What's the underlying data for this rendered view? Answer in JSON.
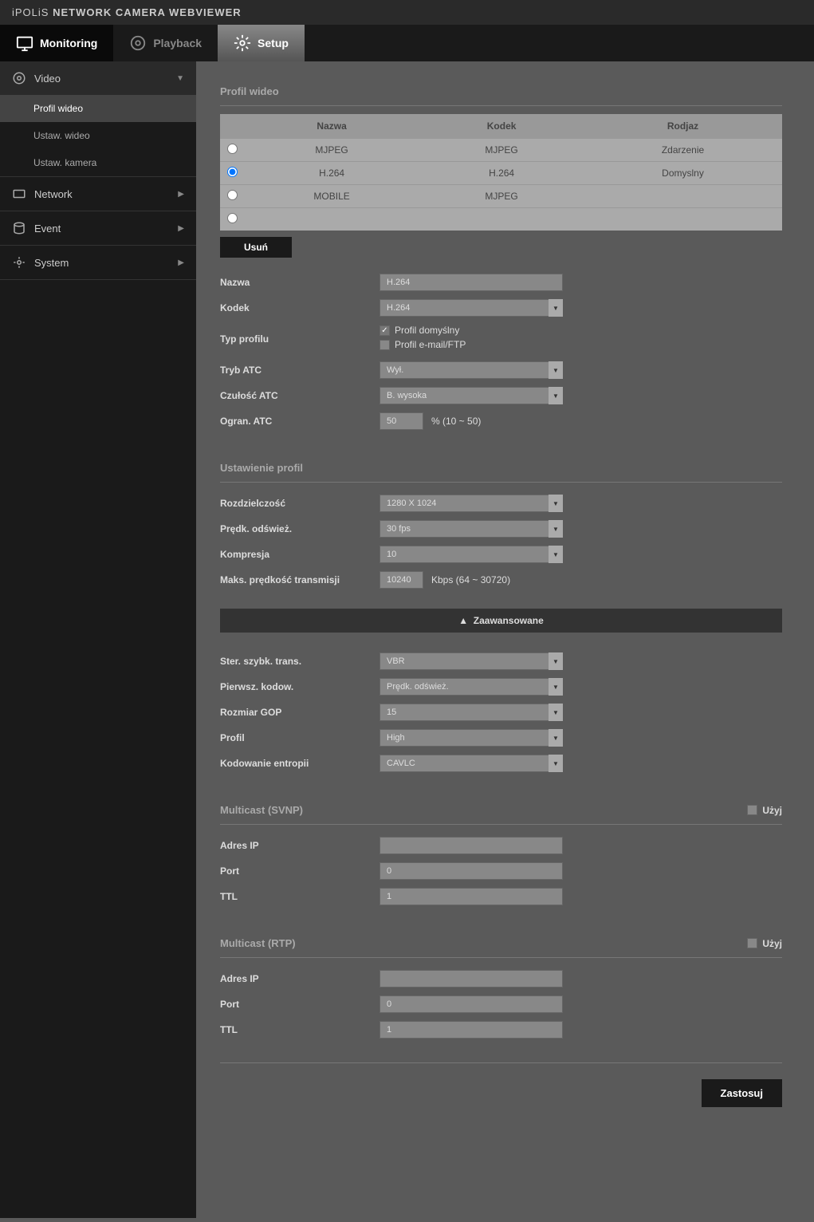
{
  "header": {
    "brand1": "iPOLiS",
    "brand2": " NETWORK CAMERA WEBVIEWER"
  },
  "tabs": {
    "monitoring": "Monitoring",
    "playback": "Playback",
    "setup": "Setup"
  },
  "sidebar": {
    "video": {
      "label": "Video",
      "items": [
        "Profil wideo",
        "Ustaw. wideo",
        "Ustaw. kamera"
      ]
    },
    "network": "Network",
    "event": "Event",
    "system": "System"
  },
  "section1": {
    "title": "Profil wideo",
    "headers": {
      "name": "Nazwa",
      "codec": "Kodek",
      "type": "Rodjaz"
    },
    "rows": [
      {
        "name": "MJPEG",
        "codec": "MJPEG",
        "type": "Zdarzenie"
      },
      {
        "name": "H.264",
        "codec": "H.264",
        "type": "Domyslny"
      },
      {
        "name": "MOBILE",
        "codec": "MJPEG",
        "type": ""
      },
      {
        "name": "",
        "codec": "",
        "type": ""
      }
    ],
    "delete": "Usuń"
  },
  "form": {
    "name_label": "Nazwa",
    "name_value": "H.264",
    "codec_label": "Kodek",
    "codec_value": "H.264",
    "profiletype_label": "Typ profilu",
    "profiletype_default": "Profil domyślny",
    "profiletype_email": "Profil e-mail/FTP",
    "atcmode_label": "Tryb ATC",
    "atcmode_value": "Wył.",
    "atcsens_label": "Czułość ATC",
    "atcsens_value": "B. wysoka",
    "atclimit_label": "Ogran. ATC",
    "atclimit_value": "50",
    "atclimit_hint": "% (10 ~ 50)"
  },
  "section2": {
    "title": "Ustawienie profil",
    "resolution_label": "Rozdzielczość",
    "resolution_value": "1280 X 1024",
    "framerate_label": "Prędk. odśwież.",
    "framerate_value": "30 fps",
    "compression_label": "Kompresja",
    "compression_value": "10",
    "maxbitrate_label": "Maks. prędkość transmisji",
    "maxbitrate_value": "10240",
    "maxbitrate_hint": "Kbps (64 ~ 30720)"
  },
  "advanced": {
    "title": "Zaawansowane",
    "bitratectl_label": "Ster. szybk. trans.",
    "bitratectl_value": "VBR",
    "encprio_label": "Pierwsz. kodow.",
    "encprio_value": "Prędk. odśwież.",
    "gop_label": "Rozmiar GOP",
    "gop_value": "15",
    "profile_label": "Profil",
    "profile_value": "High",
    "entropy_label": "Kodowanie entropii",
    "entropy_value": "CAVLC"
  },
  "multicast_svnp": {
    "title": "Multicast (SVNP)",
    "use": "Użyj",
    "ip_label": "Adres IP",
    "ip_value": "",
    "port_label": "Port",
    "port_value": "0",
    "ttl_label": "TTL",
    "ttl_value": "1"
  },
  "multicast_rtp": {
    "title": "Multicast (RTP)",
    "use": "Użyj",
    "ip_label": "Adres IP",
    "ip_value": "",
    "port_label": "Port",
    "port_value": "0",
    "ttl_label": "TTL",
    "ttl_value": "1"
  },
  "apply": "Zastosuj"
}
